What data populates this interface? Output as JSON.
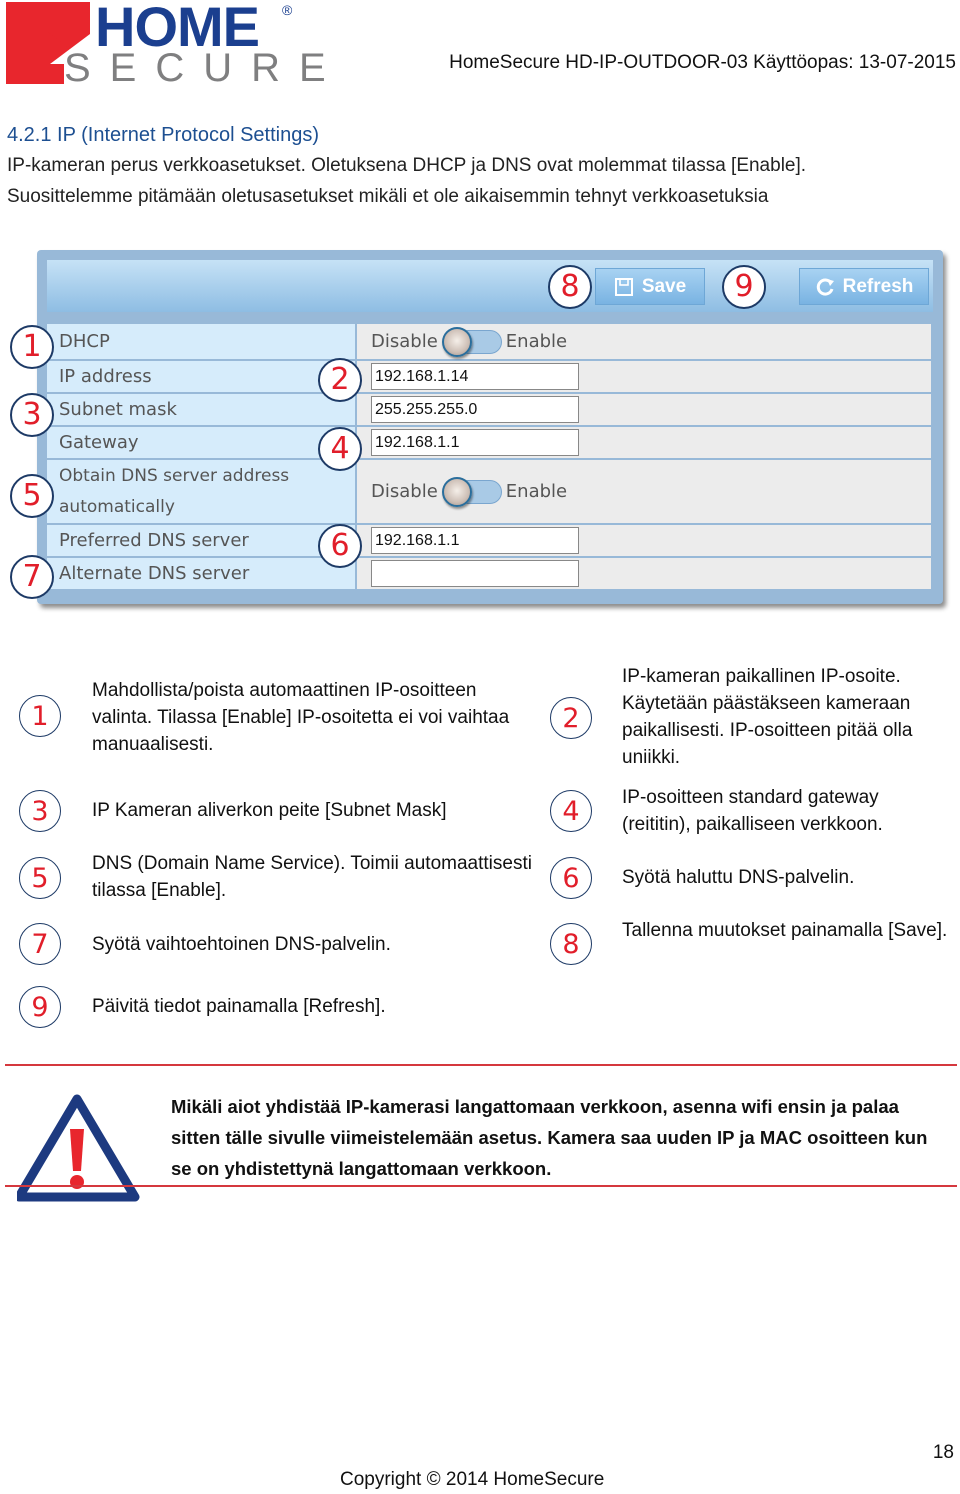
{
  "header": {
    "logo_top": "HOME",
    "logo_bottom": "SECURE",
    "logo_reg": "®",
    "doc_title": "HomeSecure HD-IP-OUTDOOR-03 Käyttöopas: 13-07-2015"
  },
  "section": {
    "title": "4.2.1 IP (Internet Protocol Settings)",
    "intro_line1": "IP-kameran perus verkkoasetukset. Oletuksena DHCP ja DNS ovat molemmat tilassa [Enable].",
    "intro_line2": "Suosittelemme pitämään oletusasetukset mikäli et ole aikaisemmin tehnyt verkkoasetuksia"
  },
  "panel": {
    "save_label": "Save",
    "refresh_label": "Refresh",
    "save_badge": "8",
    "refresh_badge": "9",
    "rows": [
      {
        "label": "DHCP",
        "type": "toggle",
        "off_label": "Disable",
        "on_label": "Enable",
        "badge": "1"
      },
      {
        "label": "IP address",
        "type": "input",
        "value": "192.168.1.14",
        "badge": "2"
      },
      {
        "label": "Subnet mask",
        "type": "input",
        "value": "255.255.255.0",
        "badge": "3"
      },
      {
        "label": "Gateway",
        "type": "input",
        "value": "192.168.1.1",
        "badge": "4"
      },
      {
        "label_line1": "Obtain DNS server address",
        "label_line2": "automatically",
        "type": "toggle",
        "off_label": "Disable",
        "on_label": "Enable",
        "badge": "5"
      },
      {
        "label": "Preferred DNS server",
        "type": "input",
        "value": "192.168.1.1",
        "badge": "6"
      },
      {
        "label": "Alternate DNS server",
        "type": "input",
        "value": "",
        "badge": "7"
      }
    ]
  },
  "legend": [
    {
      "num": "1",
      "text": "Mahdollista/poista automaattinen IP-osoitteen valinta. Tilassa [Enable] IP-osoitetta ei voi vaihtaa manuaalisesti."
    },
    {
      "num": "2",
      "text": "IP-kameran paikallinen IP-osoite. Käytetään päästäkseen kameraan paikallisesti. IP-osoitteen pitää olla uniikki."
    },
    {
      "num": "3",
      "text": "IP Kameran aliverkon peite [Subnet Mask]"
    },
    {
      "num": "4",
      "text": "IP-osoitteen standard gateway (reititin), paikalliseen verkkoon."
    },
    {
      "num": "5",
      "text": "DNS (Domain Name Service). Toimii automaattisesti tilassa [Enable]."
    },
    {
      "num": "6",
      "text": "Syötä haluttu DNS-palvelin."
    },
    {
      "num": "7",
      "text": "Syötä vaihtoehtoinen DNS-palvelin."
    },
    {
      "num": "8",
      "text": "Tallenna muutokset painamalla [Save]."
    },
    {
      "num": "9",
      "text": "Päivitä tiedot painamalla [Refresh]."
    }
  ],
  "warning": {
    "text": "Mikäli aiot yhdistää IP-kamerasi langattomaan verkkoon, asenna wifi ensin ja palaa sitten tälle sivulle viimeistelemään asetus. Kamera saa uuden IP ja MAC osoitteen kun se on yhdistettynä langattomaan verkkoon."
  },
  "footer": {
    "page_number": "18",
    "copyright": "Copyright © 2014 HomeSecure"
  },
  "colors": {
    "brand_blue": "#1b3f8f",
    "brand_red": "#e8262d",
    "badge_red": "#e11e2a",
    "panel_blue": "#98b9d8"
  }
}
